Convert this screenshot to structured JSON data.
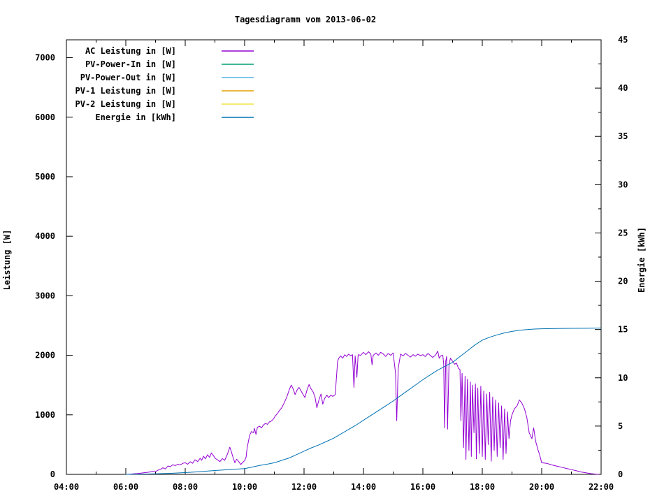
{
  "chart_data": {
    "type": "line",
    "title": "Tagesdiagramm vom 2013-06-02",
    "x_axis": {
      "range": [
        4,
        22
      ],
      "ticks": [
        {
          "v": 4,
          "label": "04:00"
        },
        {
          "v": 6,
          "label": "06:00"
        },
        {
          "v": 8,
          "label": "08:00"
        },
        {
          "v": 10,
          "label": "10:00"
        },
        {
          "v": 12,
          "label": "12:00"
        },
        {
          "v": 14,
          "label": "14:00"
        },
        {
          "v": 16,
          "label": "16:00"
        },
        {
          "v": 18,
          "label": "18:00"
        },
        {
          "v": 20,
          "label": "20:00"
        },
        {
          "v": 22,
          "label": "22:00"
        }
      ],
      "minor": [
        5,
        7,
        9,
        11,
        13,
        15,
        17,
        19,
        21
      ]
    },
    "y_left": {
      "label": "Leistung [W]",
      "range": [
        0,
        7300
      ],
      "ticks": [
        {
          "v": 0,
          "label": "0"
        },
        {
          "v": 1000,
          "label": "1000"
        },
        {
          "v": 2000,
          "label": "2000"
        },
        {
          "v": 3000,
          "label": "3000"
        },
        {
          "v": 4000,
          "label": "4000"
        },
        {
          "v": 5000,
          "label": "5000"
        },
        {
          "v": 6000,
          "label": "6000"
        },
        {
          "v": 7000,
          "label": "7000"
        }
      ]
    },
    "y_right": {
      "label": "Energie [kWh]",
      "range": [
        0,
        45
      ],
      "ticks": [
        {
          "v": 0,
          "label": "0"
        },
        {
          "v": 5,
          "label": "5"
        },
        {
          "v": 10,
          "label": "10"
        },
        {
          "v": 15,
          "label": "15"
        },
        {
          "v": 20,
          "label": "20"
        },
        {
          "v": 25,
          "label": "25"
        },
        {
          "v": 30,
          "label": "30"
        },
        {
          "v": 35,
          "label": "35"
        },
        {
          "v": 40,
          "label": "40"
        },
        {
          "v": 45,
          "label": "45"
        }
      ],
      "minor": [
        2.5,
        7.5,
        12.5,
        17.5,
        22.5,
        27.5,
        32.5,
        37.5,
        42.5
      ]
    },
    "legend": [
      {
        "label": "AC Leistung in [W]",
        "color": "#9400d3"
      },
      {
        "label": "PV-Power-In in [W]",
        "color": "#009e73"
      },
      {
        "label": "PV-Power-Out in [W]",
        "color": "#56b4e9"
      },
      {
        "label": "PV-1 Leistung in [W]",
        "color": "#e69f00"
      },
      {
        "label": "PV-2 Leistung in [W]",
        "color": "#f0e442"
      },
      {
        "label": "Energie in [kWh]",
        "color": "#0072b2"
      }
    ],
    "series": [
      {
        "name": "AC Leistung in [W]",
        "color": "#9400d3",
        "axis": "left",
        "points": [
          [
            6.08,
            0
          ],
          [
            6.25,
            8
          ],
          [
            6.42,
            15
          ],
          [
            6.58,
            25
          ],
          [
            6.75,
            35
          ],
          [
            6.92,
            50
          ],
          [
            7.0,
            45
          ],
          [
            7.08,
            70
          ],
          [
            7.17,
            85
          ],
          [
            7.25,
            110
          ],
          [
            7.33,
            90
          ],
          [
            7.42,
            140
          ],
          [
            7.5,
            130
          ],
          [
            7.58,
            160
          ],
          [
            7.67,
            148
          ],
          [
            7.75,
            170
          ],
          [
            7.83,
            158
          ],
          [
            7.92,
            185
          ],
          [
            8.0,
            195
          ],
          [
            8.08,
            170
          ],
          [
            8.17,
            212
          ],
          [
            8.25,
            185
          ],
          [
            8.33,
            245
          ],
          [
            8.42,
            215
          ],
          [
            8.5,
            270
          ],
          [
            8.55,
            235
          ],
          [
            8.62,
            305
          ],
          [
            8.68,
            260
          ],
          [
            8.75,
            330
          ],
          [
            8.82,
            285
          ],
          [
            8.88,
            360
          ],
          [
            8.95,
            315
          ],
          [
            9.0,
            275
          ],
          [
            9.08,
            245
          ],
          [
            9.17,
            215
          ],
          [
            9.25,
            265
          ],
          [
            9.33,
            235
          ],
          [
            9.42,
            340
          ],
          [
            9.5,
            455
          ],
          [
            9.55,
            385
          ],
          [
            9.6,
            300
          ],
          [
            9.67,
            195
          ],
          [
            9.73,
            255
          ],
          [
            9.8,
            215
          ],
          [
            9.87,
            165
          ],
          [
            9.93,
            200
          ],
          [
            10.0,
            230
          ],
          [
            10.05,
            290
          ],
          [
            10.08,
            430
          ],
          [
            10.13,
            560
          ],
          [
            10.17,
            660
          ],
          [
            10.23,
            720
          ],
          [
            10.3,
            700
          ],
          [
            10.33,
            775
          ],
          [
            10.38,
            670
          ],
          [
            10.43,
            790
          ],
          [
            10.5,
            810
          ],
          [
            10.57,
            780
          ],
          [
            10.63,
            830
          ],
          [
            10.7,
            855
          ],
          [
            10.77,
            840
          ],
          [
            10.83,
            880
          ],
          [
            10.9,
            895
          ],
          [
            10.97,
            930
          ],
          [
            11.03,
            980
          ],
          [
            11.1,
            1020
          ],
          [
            11.17,
            1070
          ],
          [
            11.25,
            1120
          ],
          [
            11.33,
            1200
          ],
          [
            11.42,
            1300
          ],
          [
            11.5,
            1420
          ],
          [
            11.57,
            1500
          ],
          [
            11.63,
            1440
          ],
          [
            11.7,
            1340
          ],
          [
            11.77,
            1420
          ],
          [
            11.83,
            1460
          ],
          [
            11.9,
            1400
          ],
          [
            11.97,
            1340
          ],
          [
            12.03,
            1290
          ],
          [
            12.1,
            1420
          ],
          [
            12.17,
            1510
          ],
          [
            12.23,
            1440
          ],
          [
            12.3,
            1390
          ],
          [
            12.37,
            1300
          ],
          [
            12.43,
            1120
          ],
          [
            12.5,
            1250
          ],
          [
            12.57,
            1350
          ],
          [
            12.63,
            1180
          ],
          [
            12.7,
            1280
          ],
          [
            12.77,
            1330
          ],
          [
            12.83,
            1290
          ],
          [
            12.9,
            1330
          ],
          [
            12.97,
            1310
          ],
          [
            13.05,
            1340
          ],
          [
            13.1,
            1700
          ],
          [
            13.13,
            1900
          ],
          [
            13.17,
            1950
          ],
          [
            13.23,
            1990
          ],
          [
            13.3,
            1950
          ],
          [
            13.37,
            2010
          ],
          [
            13.43,
            1980
          ],
          [
            13.5,
            2020
          ],
          [
            13.57,
            1990
          ],
          [
            13.63,
            2010
          ],
          [
            13.68,
            1460
          ],
          [
            13.72,
            1990
          ],
          [
            13.78,
            1630
          ],
          [
            13.82,
            2010
          ],
          [
            13.9,
            2000
          ],
          [
            14.0,
            2050
          ],
          [
            14.08,
            2010
          ],
          [
            14.17,
            2060
          ],
          [
            14.25,
            2020
          ],
          [
            14.29,
            1840
          ],
          [
            14.33,
            2000
          ],
          [
            14.42,
            2040
          ],
          [
            14.5,
            2000
          ],
          [
            14.58,
            2050
          ],
          [
            14.67,
            2020
          ],
          [
            14.75,
            1980
          ],
          [
            14.83,
            2030
          ],
          [
            14.92,
            2000
          ],
          [
            15.0,
            2040
          ],
          [
            15.08,
            1700
          ],
          [
            15.12,
            900
          ],
          [
            15.17,
            1780
          ],
          [
            15.25,
            2020
          ],
          [
            15.33,
            1990
          ],
          [
            15.42,
            2030
          ],
          [
            15.5,
            2000
          ],
          [
            15.58,
            1970
          ],
          [
            15.67,
            2010
          ],
          [
            15.75,
            1985
          ],
          [
            15.83,
            2020
          ],
          [
            15.92,
            1995
          ],
          [
            16.0,
            2010
          ],
          [
            16.08,
            1980
          ],
          [
            16.17,
            2030
          ],
          [
            16.25,
            2000
          ],
          [
            16.33,
            1965
          ],
          [
            16.42,
            2000
          ],
          [
            16.5,
            2070
          ],
          [
            16.55,
            1950
          ],
          [
            16.6,
            1990
          ],
          [
            16.67,
            2000
          ],
          [
            16.7,
            1860
          ],
          [
            16.73,
            780
          ],
          [
            16.77,
            1900
          ],
          [
            16.8,
            1980
          ],
          [
            16.83,
            760
          ],
          [
            16.88,
            1850
          ],
          [
            16.93,
            1950
          ],
          [
            17.0,
            1900
          ],
          [
            17.07,
            1850
          ],
          [
            17.13,
            1870
          ],
          [
            17.2,
            1780
          ],
          [
            17.25,
            1760
          ],
          [
            17.28,
            900
          ],
          [
            17.32,
            1700
          ],
          [
            17.37,
            450
          ],
          [
            17.42,
            1650
          ],
          [
            17.45,
            250
          ],
          [
            17.5,
            1600
          ],
          [
            17.55,
            400
          ],
          [
            17.6,
            1550
          ],
          [
            17.63,
            300
          ],
          [
            17.67,
            1500
          ],
          [
            17.72,
            700
          ],
          [
            17.77,
            1520
          ],
          [
            17.8,
            260
          ],
          [
            17.85,
            1450
          ],
          [
            17.9,
            350
          ],
          [
            17.95,
            1480
          ],
          [
            18.0,
            300
          ],
          [
            18.05,
            1400
          ],
          [
            18.1,
            250
          ],
          [
            18.15,
            1350
          ],
          [
            18.2,
            500
          ],
          [
            18.25,
            1380
          ],
          [
            18.3,
            220
          ],
          [
            18.35,
            1300
          ],
          [
            18.4,
            400
          ],
          [
            18.45,
            1250
          ],
          [
            18.5,
            300
          ],
          [
            18.55,
            1200
          ],
          [
            18.6,
            450
          ],
          [
            18.65,
            1150
          ],
          [
            18.7,
            250
          ],
          [
            18.75,
            1100
          ],
          [
            18.8,
            350
          ],
          [
            18.85,
            1050
          ],
          [
            18.9,
            600
          ],
          [
            18.95,
            900
          ],
          [
            19.0,
            1000
          ],
          [
            19.08,
            1100
          ],
          [
            19.17,
            1150
          ],
          [
            19.25,
            1250
          ],
          [
            19.33,
            1200
          ],
          [
            19.42,
            1100
          ],
          [
            19.5,
            950
          ],
          [
            19.58,
            700
          ],
          [
            19.67,
            600
          ],
          [
            19.73,
            780
          ],
          [
            19.8,
            550
          ],
          [
            19.87,
            420
          ],
          [
            19.93,
            330
          ],
          [
            20.0,
            195
          ],
          [
            20.17,
            185
          ],
          [
            20.33,
            160
          ],
          [
            20.5,
            140
          ],
          [
            20.67,
            120
          ],
          [
            20.83,
            100
          ],
          [
            21.0,
            80
          ],
          [
            21.17,
            60
          ],
          [
            21.33,
            40
          ],
          [
            21.5,
            25
          ],
          [
            21.67,
            12
          ],
          [
            21.83,
            4
          ],
          [
            21.92,
            0
          ]
        ]
      },
      {
        "name": "Energie in [kWh]",
        "color": "#0072b2",
        "axis": "right",
        "points": [
          [
            6.0,
            0
          ],
          [
            6.5,
            0.03
          ],
          [
            7.0,
            0.06
          ],
          [
            7.5,
            0.11
          ],
          [
            8.0,
            0.18
          ],
          [
            8.5,
            0.28
          ],
          [
            9.0,
            0.4
          ],
          [
            9.5,
            0.5
          ],
          [
            10.0,
            0.6
          ],
          [
            10.25,
            0.75
          ],
          [
            10.5,
            0.92
          ],
          [
            10.75,
            1.05
          ],
          [
            11.0,
            1.2
          ],
          [
            11.25,
            1.45
          ],
          [
            11.5,
            1.7
          ],
          [
            11.75,
            2.05
          ],
          [
            12.0,
            2.4
          ],
          [
            12.25,
            2.75
          ],
          [
            12.5,
            3.05
          ],
          [
            12.75,
            3.4
          ],
          [
            13.0,
            3.75
          ],
          [
            13.25,
            4.2
          ],
          [
            13.5,
            4.65
          ],
          [
            13.75,
            5.1
          ],
          [
            14.0,
            5.6
          ],
          [
            14.25,
            6.1
          ],
          [
            14.5,
            6.6
          ],
          [
            14.75,
            7.1
          ],
          [
            15.0,
            7.6
          ],
          [
            15.25,
            8.15
          ],
          [
            15.5,
            8.7
          ],
          [
            15.75,
            9.25
          ],
          [
            16.0,
            9.8
          ],
          [
            16.25,
            10.3
          ],
          [
            16.5,
            10.8
          ],
          [
            16.75,
            11.2
          ],
          [
            17.0,
            11.6
          ],
          [
            17.25,
            12.2
          ],
          [
            17.5,
            12.8
          ],
          [
            17.75,
            13.4
          ],
          [
            18.0,
            13.9
          ],
          [
            18.25,
            14.2
          ],
          [
            18.5,
            14.45
          ],
          [
            18.75,
            14.65
          ],
          [
            19.0,
            14.8
          ],
          [
            19.25,
            14.92
          ],
          [
            19.5,
            15.0
          ],
          [
            19.75,
            15.05
          ],
          [
            20.0,
            15.08
          ],
          [
            20.5,
            15.1
          ],
          [
            21.0,
            15.12
          ],
          [
            21.5,
            15.13
          ],
          [
            22.0,
            15.15
          ]
        ]
      }
    ]
  }
}
